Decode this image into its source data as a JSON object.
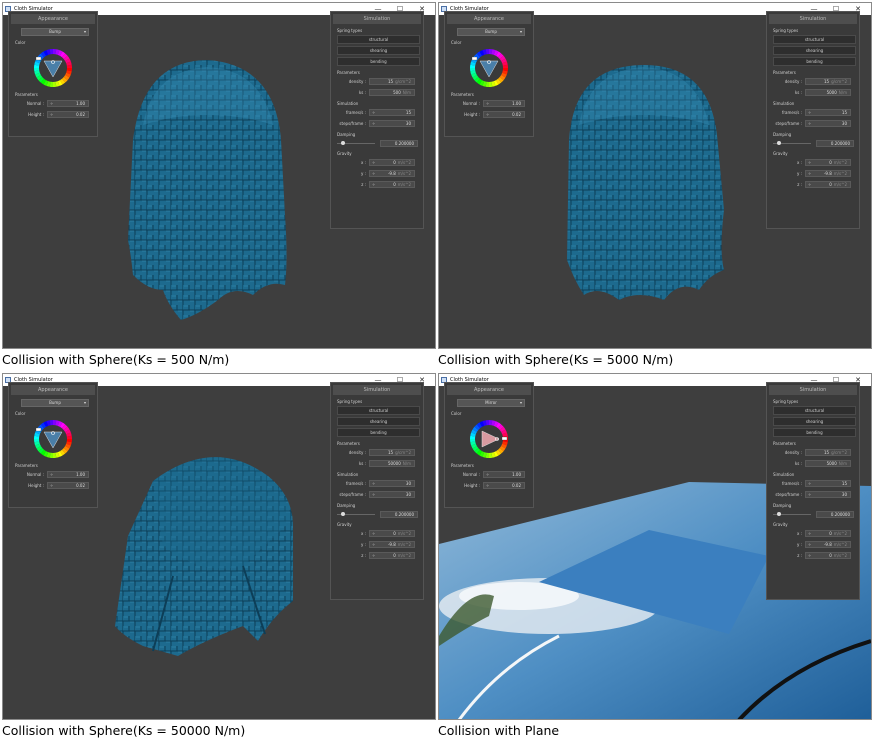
{
  "window_title": "Cloth Simulator",
  "window_buttons": [
    "—",
    "☐",
    "✕"
  ],
  "appearance": {
    "title": "Appearance",
    "color_label": "Color",
    "parameters_label": "Parameters",
    "normal_label": "Normal :",
    "height_label": "Height :"
  },
  "simulation": {
    "title": "Simulation",
    "spring_types_label": "Spring types",
    "structural": "structural",
    "shearing": "shearing",
    "bending": "bending",
    "parameters_label": "Parameters",
    "density_label": "density :",
    "ks_label": "ks :",
    "sim_label": "Simulation",
    "frames_label": "frames/s :",
    "steps_label": "steps/frame :",
    "damping_label": "Damping",
    "gravity_label": "Gravity",
    "x_label": "x :",
    "y_label": "y :",
    "z_label": "z :"
  },
  "panels": [
    {
      "caption": "Collision with Sphere(Ks = 500 N/m)",
      "shader": "Bump",
      "normal": "1.00",
      "height": "0.02",
      "density": "15",
      "density_unit": "g/cm^2",
      "ks": "500",
      "ks_unit": "N/m",
      "frames": "15",
      "steps": "30",
      "damping": "0.200000",
      "gx": "0",
      "gy": "-9.8",
      "gz": "0",
      "g_unit": "m/s^2",
      "cloth_color": "#1d6a8e",
      "scene": "sphere-500"
    },
    {
      "caption": "Collision with Sphere(Ks = 5000 N/m)",
      "shader": "Bump",
      "normal": "1.00",
      "height": "0.02",
      "density": "15",
      "density_unit": "g/cm^2",
      "ks": "5000",
      "ks_unit": "N/m",
      "frames": "15",
      "steps": "30",
      "damping": "0.200000",
      "gx": "0",
      "gy": "-9.8",
      "gz": "0",
      "g_unit": "m/s^2",
      "cloth_color": "#1d6a8e",
      "scene": "sphere-5000"
    },
    {
      "caption": "Collision with Sphere(Ks = 50000 N/m)",
      "shader": "Bump",
      "normal": "1.00",
      "height": "0.02",
      "density": "15",
      "density_unit": "g/cm^2",
      "ks": "50000",
      "ks_unit": "N/m",
      "frames": "30",
      "steps": "30",
      "damping": "0.200000",
      "gx": "0",
      "gy": "-9.8",
      "gz": "0",
      "g_unit": "m/s^2",
      "cloth_color": "#1d6a8e",
      "scene": "sphere-50000"
    },
    {
      "caption": "Collision with Plane",
      "shader": "Mirror",
      "normal": "1.00",
      "height": "0.02",
      "density": "15",
      "density_unit": "g/cm^2",
      "ks": "5000",
      "ks_unit": "N/m",
      "frames": "15",
      "steps": "30",
      "damping": "0.200000",
      "gx": "0",
      "gy": "-9.8",
      "gz": "0",
      "g_unit": "m/s^2",
      "cloth_color": "#3b7fbf",
      "scene": "plane"
    }
  ]
}
